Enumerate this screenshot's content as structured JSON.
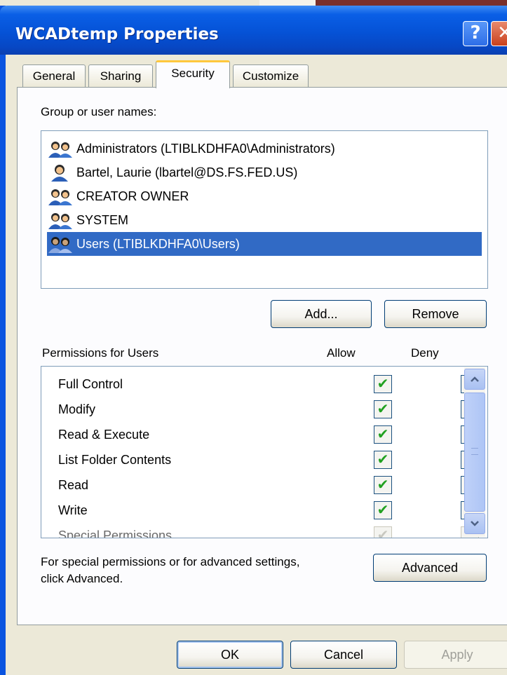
{
  "window": {
    "title": "WCADtemp Properties",
    "help_glyph": "?",
    "close_glyph": "✕"
  },
  "tabs": [
    {
      "label": "General",
      "active": false
    },
    {
      "label": "Sharing",
      "active": false
    },
    {
      "label": "Security",
      "active": true
    },
    {
      "label": "Customize",
      "active": false
    }
  ],
  "security": {
    "group_label": "Group or user names:",
    "users": [
      {
        "name": "Administrators (LTIBLKDHFA0\\Administrators)",
        "icon": "group-icon",
        "selected": false
      },
      {
        "name": "Bartel, Laurie (lbartel@DS.FS.FED.US)",
        "icon": "user-icon",
        "selected": false
      },
      {
        "name": "CREATOR OWNER",
        "icon": "group-icon",
        "selected": false
      },
      {
        "name": "SYSTEM",
        "icon": "group-icon",
        "selected": false
      },
      {
        "name": "Users (LTIBLKDHFA0\\Users)",
        "icon": "group-icon",
        "selected": true
      }
    ],
    "add_label": "Add...",
    "remove_label": "Remove",
    "permissions_label": "Permissions for Users",
    "allow_label": "Allow",
    "deny_label": "Deny",
    "permissions": [
      {
        "name": "Full Control",
        "allow": true,
        "deny": false,
        "greyed": false
      },
      {
        "name": "Modify",
        "allow": true,
        "deny": false,
        "greyed": false
      },
      {
        "name": "Read & Execute",
        "allow": true,
        "deny": false,
        "greyed": false
      },
      {
        "name": "List Folder Contents",
        "allow": true,
        "deny": false,
        "greyed": false
      },
      {
        "name": "Read",
        "allow": true,
        "deny": false,
        "greyed": false
      },
      {
        "name": "Write",
        "allow": true,
        "deny": false,
        "greyed": false
      },
      {
        "name": "Special Permissions",
        "allow": true,
        "deny": false,
        "greyed": true
      }
    ],
    "advanced_text_line1": "For special permissions or for advanced settings,",
    "advanced_text_line2": "click Advanced.",
    "advanced_label": "Advanced"
  },
  "footer": {
    "ok_label": "OK",
    "cancel_label": "Cancel",
    "apply_label": "Apply",
    "apply_enabled": false
  },
  "colors": {
    "titlebar": "#0552d6",
    "selection": "#316ac5",
    "check": "#21a121",
    "active_tab_accent": "#ffc83c"
  }
}
